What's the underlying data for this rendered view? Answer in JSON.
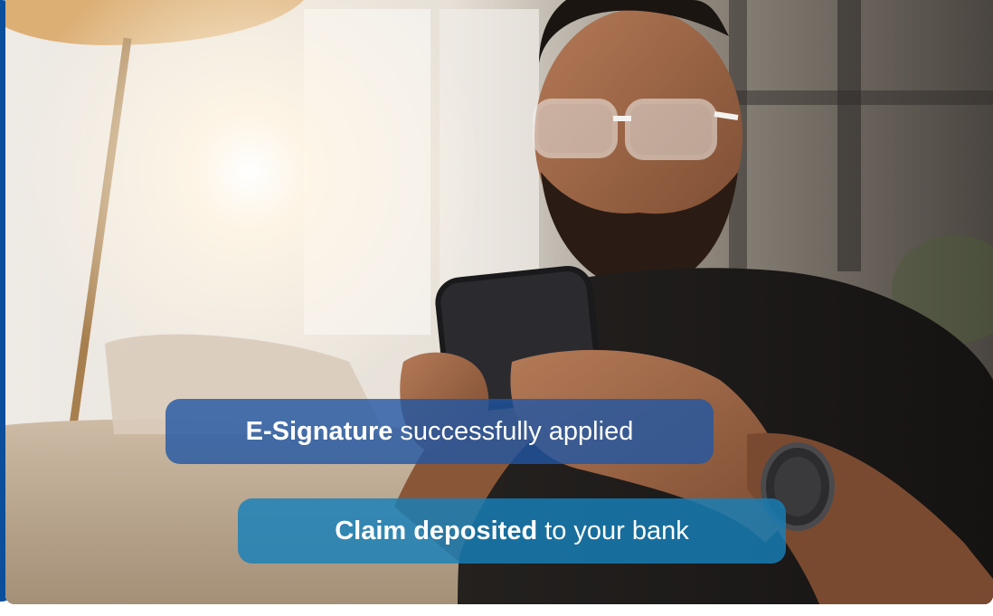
{
  "overlays": {
    "esignature": {
      "strong": "E-Signature",
      "rest": "successfully applied"
    },
    "deposit": {
      "strong": "Claim deposited",
      "rest": "to your bank"
    }
  },
  "colors": {
    "edge_blue": "#0b4f9c",
    "pill_primary": "#2056a4",
    "pill_secondary": "#1680ba"
  }
}
